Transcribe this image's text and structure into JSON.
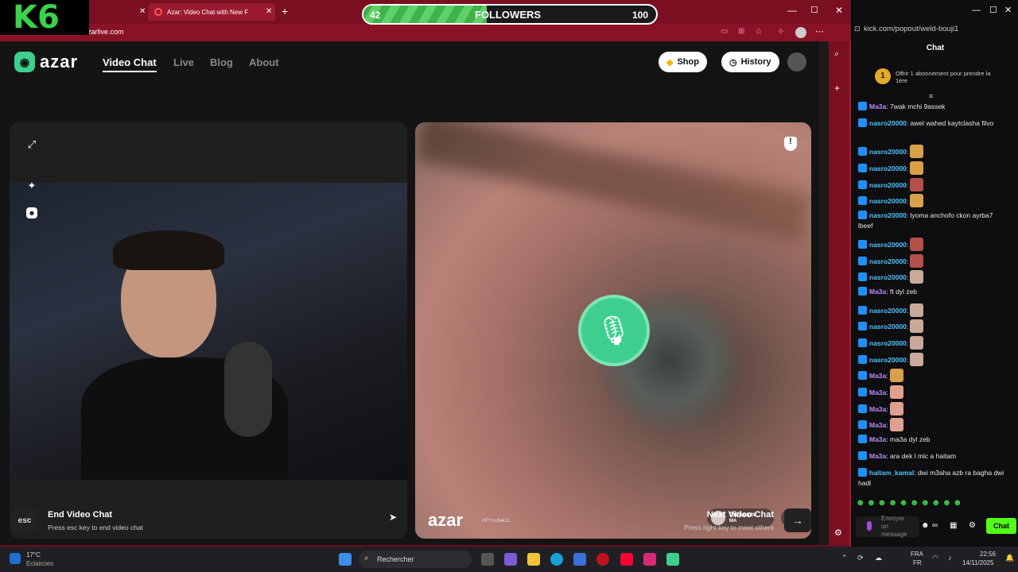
{
  "overlay": {
    "logo_text": "K6",
    "followers_current": "42",
    "followers_label": "FOLLOWERS",
    "followers_goal": "100",
    "followers_progress": 0.42
  },
  "browser": {
    "tab_title": "Azar: Video Chat with New F",
    "address": "azarlive.com"
  },
  "azar": {
    "logo": "azar",
    "nav": [
      "Video Chat",
      "Live",
      "Blog",
      "About"
    ],
    "shop_label": "Shop",
    "history_label": "History",
    "watermark": "azar",
    "watermark_id": "HFYns3wk11",
    "partner_name": "Ibtissam",
    "partner_country": "MA",
    "end_key": "esc",
    "end_title": "End Video Chat",
    "end_sub": "Press esc key to end video chat",
    "next_title": "Next Video Chat",
    "next_sub": "Press right key to meet others"
  },
  "chat": {
    "url": "kick.com/popout/weld-bouji1",
    "title": "Chat",
    "pinned": "Offrir 1 abonnement pour prendre la 1ère",
    "pinned_count": "1",
    "messages": [
      {
        "user": "Ma3a",
        "text": ": 7wak mchi 9assek"
      },
      {
        "user": "nasro20000",
        "text": ": awel wahed kaytclasha filvo"
      },
      {
        "user": "nasro20000",
        "text": ":"
      },
      {
        "user": "nasro20000",
        "text": ":"
      },
      {
        "user": "nasro20000",
        "text": ":"
      },
      {
        "user": "nasro20000",
        "text": ":"
      },
      {
        "user": "nasro20000",
        "text": ": lyoma anchofo ckon ayrba7 lbeef"
      },
      {
        "user": "nasro20000",
        "text": ":"
      },
      {
        "user": "nasro20000",
        "text": ":"
      },
      {
        "user": "nasro20000",
        "text": ":"
      },
      {
        "user": "Ma3a",
        "text": ": ft dyl zeb"
      },
      {
        "user": "nasro20000",
        "text": ":"
      },
      {
        "user": "nasro20000",
        "text": ":"
      },
      {
        "user": "nasro20000",
        "text": ":"
      },
      {
        "user": "nasro20000",
        "text": ":"
      },
      {
        "user": "Ma3a",
        "text": ":"
      },
      {
        "user": "Ma3a",
        "text": ":"
      },
      {
        "user": "Ma3a",
        "text": ":"
      },
      {
        "user": "Ma3a",
        "text": ":"
      },
      {
        "user": "Ma3a",
        "text": ": ma3a dyl zeb"
      },
      {
        "user": "Ma3a",
        "text": ": ara dek l mic a haitam"
      },
      {
        "user": "haitam_kamal",
        "text": ": dwi m3aha azb ra bagha dwi hadl"
      }
    ],
    "input_placeholder": "Envoyer un message",
    "send_label": "Chat"
  },
  "taskbar": {
    "weather_temp": "17°C",
    "weather_desc": "Eclaircies",
    "search_label": "Rechercher",
    "lang_top": "FRA",
    "lang_bottom": "FR",
    "time": "22:56",
    "date": "14/11/2025"
  }
}
